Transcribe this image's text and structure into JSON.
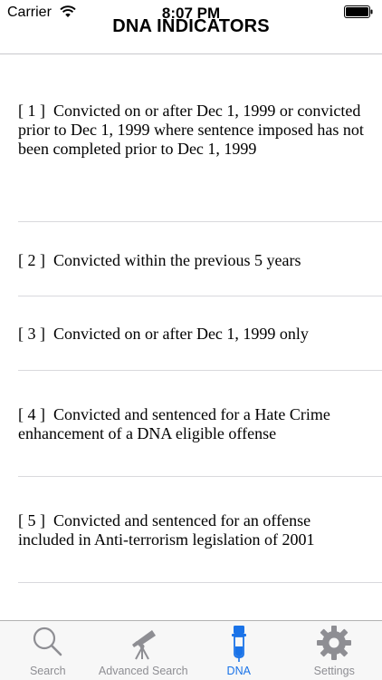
{
  "status_bar": {
    "carrier": "Carrier",
    "time": "8:07 PM"
  },
  "nav": {
    "title": "DNA INDICATORS"
  },
  "indicators": [
    {
      "number": "[ 1 ]",
      "text": "Convicted on or after Dec 1, 1999 or convicted prior to Dec 1, 1999 where sentence imposed has not been completed prior to Dec 1, 1999"
    },
    {
      "number": "[ 2 ]",
      "text": "Convicted within the previous 5 years"
    },
    {
      "number": "[ 3 ]",
      "text": "Convicted on or after Dec 1, 1999 only"
    },
    {
      "number": "[ 4 ]",
      "text": "Convicted and sentenced for a Hate Crime enhancement of a DNA eligible offense"
    },
    {
      "number": "[ 5 ]",
      "text": "Convicted and sentenced for an offense included in Anti-terrorism legislation of 2001"
    }
  ],
  "tabs": [
    {
      "label": "Search",
      "icon": "magnifier-icon"
    },
    {
      "label": "Advanced Search",
      "icon": "telescope-icon"
    },
    {
      "label": "DNA",
      "icon": "test-tube-icon",
      "active": true
    },
    {
      "label": "Settings",
      "icon": "gear-icon"
    }
  ],
  "colors": {
    "active_tab": "#1a73e8",
    "inactive_tab": "#8e8e93",
    "separator": "#d9d9dd"
  }
}
